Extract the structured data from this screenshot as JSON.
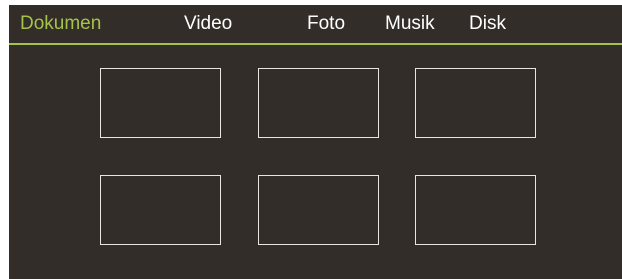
{
  "tabs": [
    {
      "label": "Dokumen",
      "active": true
    },
    {
      "label": "Video",
      "active": false
    },
    {
      "label": "Foto",
      "active": false
    },
    {
      "label": "Musik",
      "active": false
    },
    {
      "label": "Disk",
      "active": false
    }
  ],
  "grid": {
    "tiles": [
      {
        "label": ""
      },
      {
        "label": ""
      },
      {
        "label": ""
      },
      {
        "label": ""
      },
      {
        "label": ""
      },
      {
        "label": ""
      }
    ]
  },
  "colors": {
    "background": "#322d28",
    "accent": "#a5c24b",
    "text": "#ffffff",
    "tile_border": "#e8e4df"
  }
}
